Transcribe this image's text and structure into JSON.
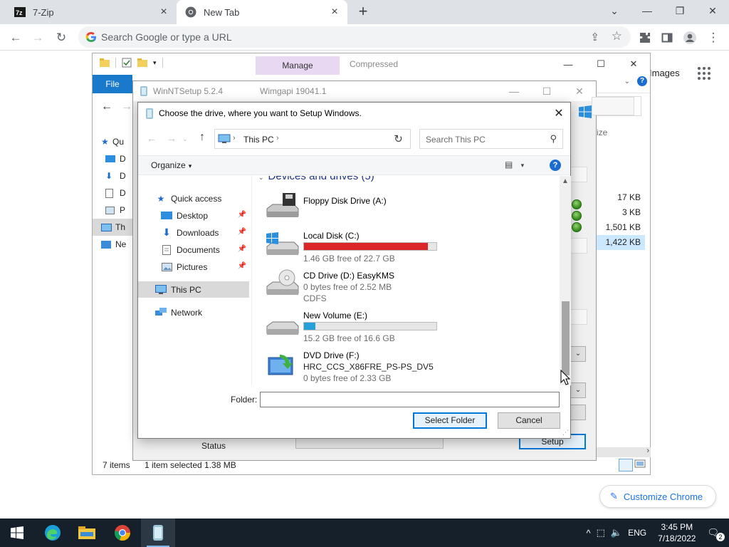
{
  "chrome": {
    "tabs": [
      {
        "title": "7-Zip",
        "icon": "7zip-icon"
      },
      {
        "title": "New Tab",
        "icon": "chrome-icon",
        "active": true
      }
    ],
    "omnibox_placeholder": "Search Google or type a URL",
    "ntp": {
      "images_link": "Images",
      "customize_label": "Customize Chrome"
    }
  },
  "explorer": {
    "ribbon_file": "File",
    "ribbon_manage": "Manage",
    "ribbon_compressed": "Compressed",
    "size_header": "ize",
    "sidebar_fragments": [
      "Qu",
      "D",
      "D",
      "D",
      "P",
      "Th",
      "Ne"
    ],
    "sizes": [
      "17 KB",
      "3 KB",
      "1,501 KB",
      "1,422 KB"
    ],
    "status_items": "7 items",
    "status_selected": "1 item selected  1.38 MB"
  },
  "winntsetup": {
    "title": "WinNTSetup 5.2.4",
    "wimgapi": "Wimgapi 19041.1",
    "status_label": "Status",
    "setup_button": "Setup"
  },
  "dialog": {
    "title": "Choose the drive, where you want to Setup Windows.",
    "address_crumb": "This PC",
    "search_placeholder": "Search This PC",
    "organize_label": "Organize",
    "nav": {
      "quick_access": "Quick access",
      "desktop": "Desktop",
      "downloads": "Downloads",
      "documents": "Documents",
      "pictures": "Pictures",
      "this_pc": "This PC",
      "network": "Network"
    },
    "group_header": "Devices and drives (5)",
    "drives": [
      {
        "name": "Floppy Disk Drive (A:)",
        "line2": "",
        "line3": "",
        "usage": null
      },
      {
        "name": "Local Disk (C:)",
        "line2": "1.46 GB free of 22.7 GB",
        "line3": "",
        "usage": 0.936,
        "bar_color": "#da2626"
      },
      {
        "name": "CD Drive (D:) EasyKMS",
        "line2": "0 bytes free of 2.52 MB",
        "line3": "CDFS",
        "usage": null
      },
      {
        "name": "New Volume (E:)",
        "line2": "15.2 GB free of 16.6 GB",
        "line3": "",
        "usage": 0.084,
        "bar_color": "#26a0da"
      },
      {
        "name": "DVD Drive (F:)",
        "line2": "HRC_CCS_X86FRE_PS-PS_DV5",
        "line3": "0 bytes free of 2.33 GB",
        "usage": null
      }
    ],
    "folder_label": "Folder:",
    "folder_value": "",
    "select_button": "Select Folder",
    "cancel_button": "Cancel"
  },
  "taskbar": {
    "apps": [
      "start-icon",
      "edge-icon",
      "file-explorer-icon",
      "chrome-icon",
      "winntsetup-icon"
    ],
    "language": "ENG",
    "time": "3:45 PM",
    "date": "7/18/2022",
    "notification_count": "2"
  },
  "colors": {
    "accent": "#0078d7",
    "file_tab": "#1979ca",
    "manage_tab": "#e9d8f2",
    "drive_bar_c": "#da2626",
    "drive_bar_e": "#26a0da",
    "taskbar": "#16202a"
  }
}
